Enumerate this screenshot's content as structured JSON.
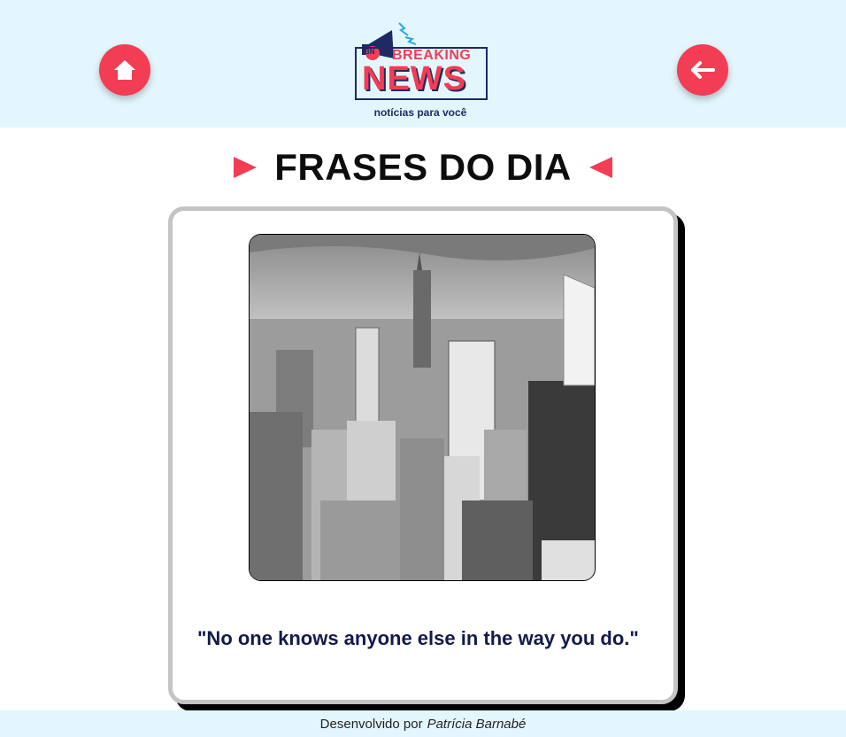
{
  "header": {
    "logo": {
      "badge": "BN",
      "line1": "BREAKING",
      "line2": "NEWS",
      "tagline": "notícias para você"
    },
    "home_button_icon": "home-icon",
    "back_button_icon": "arrow-left-icon",
    "accent_color": "#f23d55",
    "background_color": "#e4f6fd"
  },
  "main": {
    "title": "FRASES DO DIA",
    "card": {
      "image_subject": "city-skyline-photo",
      "quote": "\"No one knows anyone else in the way you do.\""
    }
  },
  "footer": {
    "prefix": "Desenvolvido por",
    "author": "Patrícia Barnabé"
  }
}
